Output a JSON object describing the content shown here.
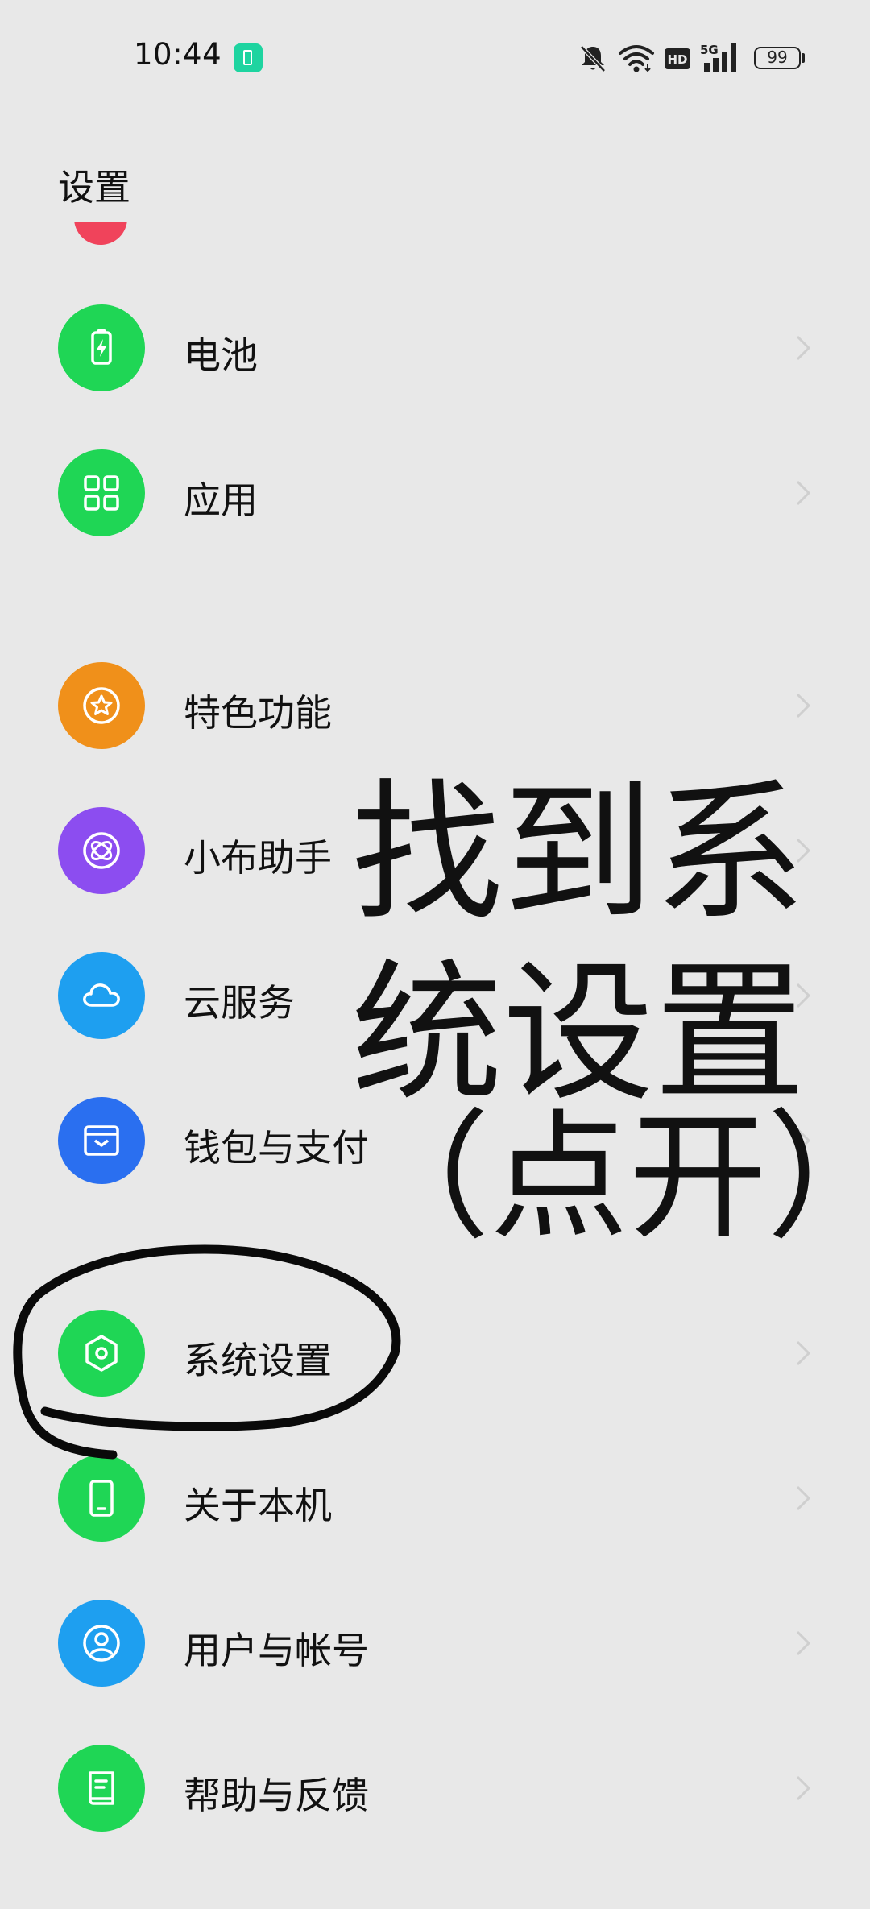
{
  "status_bar": {
    "time": "10:44",
    "battery_level": "99",
    "icons": [
      "battery-saver-icon",
      "bell-muted-icon",
      "wifi-icon",
      "hd-icon",
      "signal-5g-icon",
      "battery-icon"
    ]
  },
  "header": {
    "title": "设置"
  },
  "settings_items": [
    {
      "label": "电池",
      "icon": "battery-icon",
      "color": "#1fd655"
    },
    {
      "label": "应用",
      "icon": "apps-grid-icon",
      "color": "#1fd655"
    },
    {
      "label": "特色功能",
      "icon": "star-badge-icon",
      "color": "#f0901a"
    },
    {
      "label": "小布助手",
      "icon": "assistant-icon",
      "color": "#8c4df0"
    },
    {
      "label": "云服务",
      "icon": "cloud-icon",
      "color": "#1e9ff0"
    },
    {
      "label": "钱包与支付",
      "icon": "wallet-icon",
      "color": "#2a6ff0"
    },
    {
      "label": "系统设置",
      "icon": "system-settings-icon",
      "color": "#1fd655"
    },
    {
      "label": "关于本机",
      "icon": "phone-icon",
      "color": "#1fd655"
    },
    {
      "label": "用户与帐号",
      "icon": "user-account-icon",
      "color": "#1e9ff0"
    },
    {
      "label": "帮助与反馈",
      "icon": "help-book-icon",
      "color": "#1fd655"
    }
  ],
  "annotation": {
    "line1": "找到系",
    "line2": "统设置",
    "line3": "（点开）"
  }
}
